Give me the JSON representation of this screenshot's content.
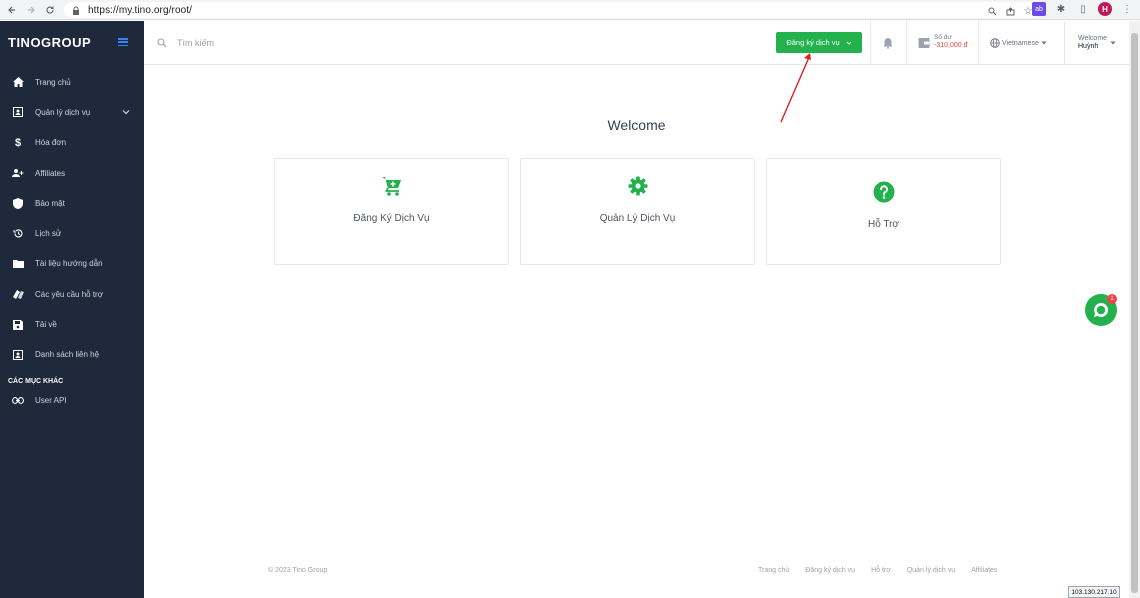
{
  "browser": {
    "url": "https://my.tino.org/root/"
  },
  "sidebar": {
    "logo": "TINOGROUP",
    "items": [
      {
        "label": "Trang chủ",
        "icon": "home-icon"
      },
      {
        "label": "Quản lý dịch vụ",
        "icon": "id-card-icon",
        "has_submenu": true
      },
      {
        "label": "Hóa đơn",
        "icon": "dollar-icon"
      },
      {
        "label": "Affiliates",
        "icon": "user-plus-icon"
      },
      {
        "label": "Bảo mật",
        "icon": "shield-icon"
      },
      {
        "label": "Lịch sử",
        "icon": "history-icon"
      },
      {
        "label": "Tài liệu hướng dẫn",
        "icon": "folder-icon"
      },
      {
        "label": "Các yêu cầu hỗ trợ",
        "icon": "tickets-icon"
      },
      {
        "label": "Tải về",
        "icon": "save-icon"
      },
      {
        "label": "Danh sách liên hệ",
        "icon": "contact-icon"
      }
    ],
    "section_label": "CÁC MỤC KHÁC",
    "extra_items": [
      {
        "label": "User API",
        "icon": "link-icon"
      }
    ]
  },
  "topbar": {
    "search_placeholder": "Tìm kiếm",
    "register_button": "Đăng ký dịch vụ",
    "balance_label": "Số dư",
    "balance_value": "-310,000 đ",
    "language": "Vietnamese",
    "welcome": "Welcome",
    "user_name": "Huỳnh"
  },
  "main": {
    "title": "Welcome",
    "cards": [
      {
        "label": "Đăng Ký Dịch Vụ",
        "icon": "cart-icon"
      },
      {
        "label": "Quản Lý Dịch Vụ",
        "icon": "gear-icon"
      },
      {
        "label": "Hỗ Trợ",
        "icon": "question-icon"
      }
    ]
  },
  "chat": {
    "badge_count": "1"
  },
  "footer": {
    "copyright": "© 2023 Tino Group",
    "links": [
      "Trang chủ",
      "Đăng ký dịch vụ",
      "Hỗ trợ",
      "Quản lý dịch vụ",
      "Affiliates"
    ]
  },
  "ip_address": "103.130.217.10",
  "colors": {
    "sidebar_bg": "#1e293b",
    "accent_green": "#22b14c",
    "balance_red": "#ef4444"
  }
}
